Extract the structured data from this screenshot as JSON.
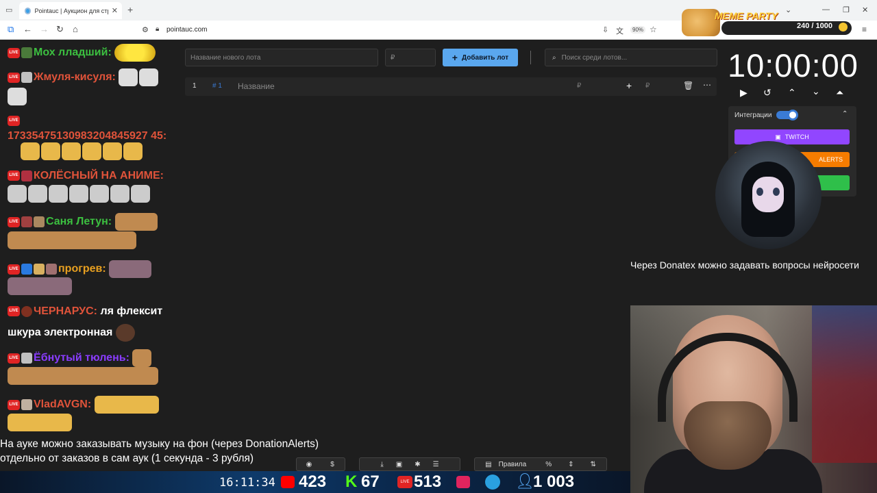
{
  "browser": {
    "tab_title": "Pointauc | Аукцион для стримера",
    "url": "pointauc.com",
    "zoom": "90%"
  },
  "meme_party": {
    "title": "MEME PARTY",
    "counter": "240 / 1000"
  },
  "toolbar": {
    "new_lot_placeholder": "Название нового лота",
    "price_placeholder": "₽",
    "add_button": "Добавить лот",
    "search_placeholder": "Поиск среди лотов..."
  },
  "lot": {
    "index": "1",
    "number": "# 1",
    "name": "Название",
    "currency": "₽"
  },
  "timer": {
    "value": "10:00:00"
  },
  "integrations": {
    "label": "Интеграции",
    "twitch": "TWITCH",
    "donationalerts": "ALERTS",
    "colors": {
      "twitch": "#9146ff",
      "da": "#f57c00",
      "green": "#2fbf4a"
    }
  },
  "overlay": {
    "donatex_text": "Через Donatex можно задавать вопросы нейросети",
    "music_line1": "На ауке можно заказывать музыку на фон (через DonationAlerts)",
    "music_line2": "отдельно от заказов в сам аук (1 секунда - 3 рубля)"
  },
  "chat": [
    {
      "name": "Мох лладший:",
      "color": "#3cc040"
    },
    {
      "name": "Жмуля-кисуля:",
      "color": "#e0533a"
    },
    {
      "name": "17335475130983204845927 45:",
      "color": "#e0533a"
    },
    {
      "name": "КОЛЁСНЫЙ НА АНИМЕ:",
      "color": "#e0533a"
    },
    {
      "name": "Саня Летун:",
      "color": "#3cc040"
    },
    {
      "name": "прогрев:",
      "color": "#e8a020"
    },
    {
      "name": "ЧЕРНАРУС:",
      "color": "#e0533a",
      "message": "ля флексит",
      "message2": "шкура электронная"
    },
    {
      "name": "Ёбнутый тюлень:",
      "color": "#8a3cff"
    },
    {
      "name": "VladAVGN:",
      "color": "#e0533a"
    }
  ],
  "bottom_buttons": {
    "rules": "Правила",
    "percent": "%"
  },
  "status": {
    "clock": "16:11:34",
    "youtube": "423",
    "kick": "67",
    "vk": "513",
    "telegram_viewers": "1 003"
  }
}
